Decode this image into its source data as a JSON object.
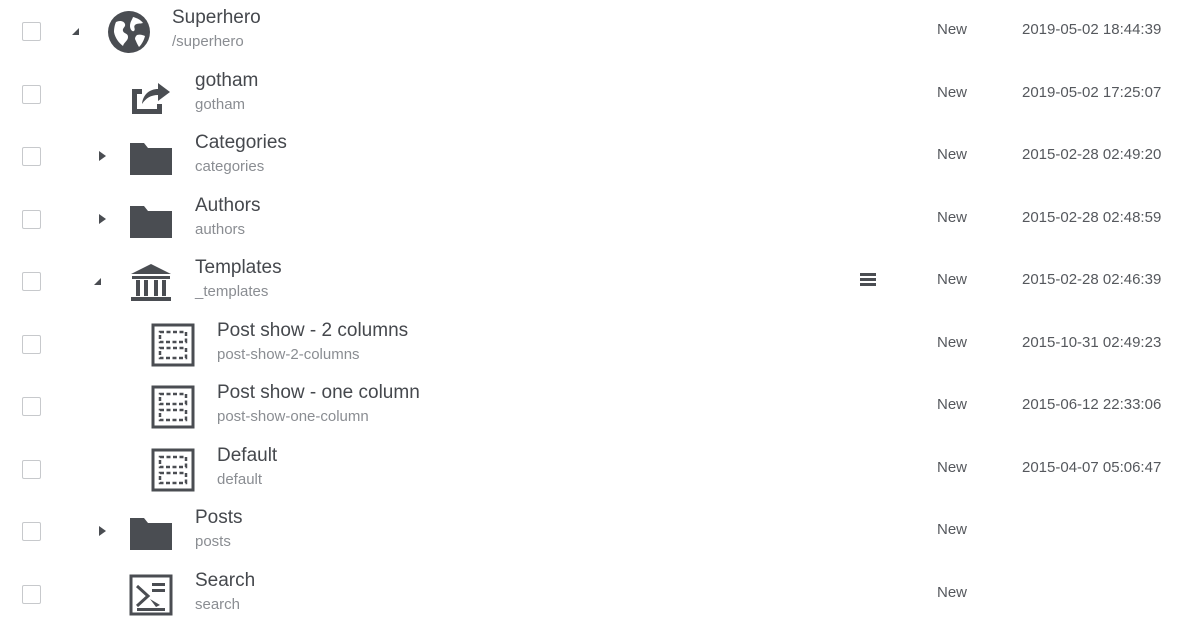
{
  "rows": [
    {
      "title": "Superhero",
      "path": "/superhero",
      "status": "New",
      "date": "2019-05-02 18:44:39",
      "icon": "globe-icon",
      "toggle": "expanded"
    },
    {
      "title": "gotham",
      "path": "gotham",
      "status": "New",
      "date": "2019-05-02 17:25:07",
      "icon": "redirect-icon",
      "toggle": "none"
    },
    {
      "title": "Categories",
      "path": "categories",
      "status": "New",
      "date": "2015-02-28 02:49:20",
      "icon": "folder-icon",
      "toggle": "collapsed"
    },
    {
      "title": "Authors",
      "path": "authors",
      "status": "New",
      "date": "2015-02-28 02:48:59",
      "icon": "folder-icon",
      "toggle": "collapsed"
    },
    {
      "title": "Templates",
      "path": "_templates",
      "status": "New",
      "date": "2015-02-28 02:46:39",
      "icon": "templates-building-icon",
      "toggle": "expanded"
    },
    {
      "title": "Post show - 2 columns",
      "path": "post-show-2-columns",
      "status": "New",
      "date": "2015-10-31 02:49:23",
      "icon": "layout-template-icon",
      "toggle": "none"
    },
    {
      "title": "Post show - one column",
      "path": "post-show-one-column",
      "status": "New",
      "date": "2015-06-12 22:33:06",
      "icon": "layout-template-icon",
      "toggle": "none"
    },
    {
      "title": "Default",
      "path": "default",
      "status": "New",
      "date": "2015-04-07 05:06:47",
      "icon": "layout-template-icon",
      "toggle": "none"
    },
    {
      "title": "Posts",
      "path": "posts",
      "status": "New",
      "date": "",
      "icon": "folder-icon",
      "toggle": "collapsed"
    },
    {
      "title": "Search",
      "path": "search",
      "status": "New",
      "date": "",
      "icon": "search-page-icon",
      "toggle": "none"
    }
  ],
  "colors": {
    "icon": "#4a4d52",
    "text": "#45484d",
    "muted": "#8a8d92",
    "checkbox_border": "#c7c9cc"
  },
  "row_actions": {
    "row": 4,
    "icon": "hamburger-menu-icon"
  }
}
